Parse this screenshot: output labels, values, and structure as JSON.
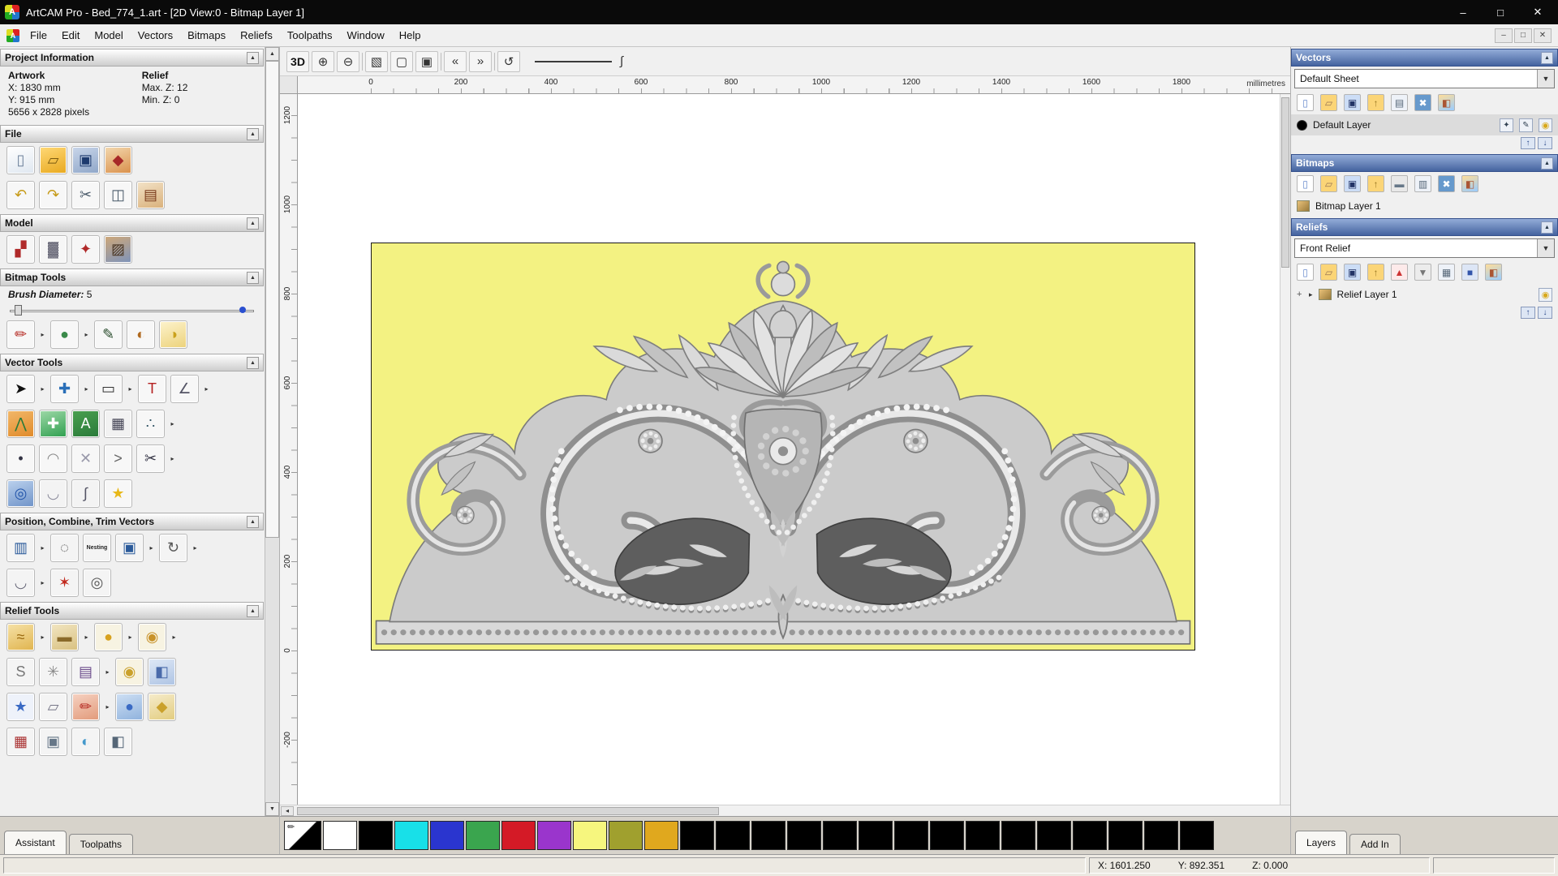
{
  "glyphs": {
    "collapse": "▲",
    "dropdown": "▼",
    "scroll_up": "▲",
    "scroll_down": "▼",
    "up": "↑",
    "down": "↓",
    "minimize": "–",
    "maximize": "□",
    "close": "✕",
    "logo_letter": "A",
    "left_arrow": "◂",
    "integral": "∫",
    "pencil": "✏",
    "plus": "+",
    "caret": "▸",
    "bulb": "●",
    "edit": "✎",
    "snap": "✦",
    "visibility": "◉"
  },
  "window": {
    "title": "ArtCAM Pro - Bed_774_1.art - [2D View:0 - Bitmap Layer 1]"
  },
  "menubar": {
    "items": [
      {
        "label": "File",
        "name": "menu-file"
      },
      {
        "label": "Edit",
        "name": "menu-edit"
      },
      {
        "label": "Model",
        "name": "menu-model"
      },
      {
        "label": "Vectors",
        "name": "menu-vectors"
      },
      {
        "label": "Bitmaps",
        "name": "menu-bitmaps"
      },
      {
        "label": "Reliefs",
        "name": "menu-reliefs"
      },
      {
        "label": "Toolpaths",
        "name": "menu-toolpaths"
      },
      {
        "label": "Window",
        "name": "menu-window"
      },
      {
        "label": "Help",
        "name": "menu-help"
      }
    ]
  },
  "assistant": {
    "project_information": {
      "title": "Project Information",
      "artwork_label": "Artwork",
      "relief_label": "Relief",
      "x": "X: 1830 mm",
      "y": "Y: 915 mm",
      "pixels": "5656 x 2828 pixels",
      "max_z": "Max. Z: 12",
      "min_z": "Min. Z: 0"
    },
    "sections": {
      "file": "File",
      "model": "Model",
      "bitmap_tools": "Bitmap Tools",
      "vector_tools": "Vector Tools",
      "position": "Position, Combine, Trim Vectors",
      "relief_tools": "Relief Tools"
    },
    "brush": {
      "label": "Brush Diameter:",
      "value": "5"
    },
    "file_icons_1": [
      {
        "name": "new-model-icon",
        "ch": "▯",
        "fg": "#6b7f99",
        "bg": "linear-gradient(160deg,#ffffff,#dfe7f0)"
      },
      {
        "name": "open-model-icon",
        "ch": "▱",
        "fg": "#7a5a10",
        "bg": "linear-gradient(160deg,#ffd977,#e8a81e)"
      },
      {
        "name": "save-model-icon",
        "ch": "▣",
        "fg": "#1d3a6e",
        "bg": "linear-gradient(160deg,#c9d6ea,#8fa6c8)"
      },
      {
        "name": "import-3d-model-icon",
        "ch": "◆",
        "fg": "#a62828",
        "bg": "linear-gradient(160deg,#f3d9b0,#d98f4a)"
      }
    ],
    "file_icons_2": [
      {
        "name": "undo-icon",
        "ch": "↶",
        "fg": "#c69a17",
        "bg": "#f7f7f7"
      },
      {
        "name": "redo-icon",
        "ch": "↷",
        "fg": "#c69a17",
        "bg": "#f7f7f7"
      },
      {
        "name": "cut-icon",
        "ch": "✂",
        "fg": "#4a5a6a",
        "bg": "#f7f7f7"
      },
      {
        "name": "copy-icon",
        "ch": "◫",
        "fg": "#4a5a6a",
        "bg": "#f7f7f7"
      },
      {
        "name": "paste-icon",
        "ch": "▤",
        "fg": "#7a3b1c",
        "bg": "linear-gradient(160deg,#f3e3c8,#d9b07a)"
      }
    ],
    "model_icons": [
      {
        "name": "invert-relief-icon",
        "ch": "▞",
        "fg": "#b02a2a",
        "bg": "#f6f6f6"
      },
      {
        "name": "relief-from-image-icon",
        "ch": "▓",
        "fg": "#556",
        "bg": "#f6f6f6"
      },
      {
        "name": "scale-model-icon",
        "ch": "✦",
        "fg": "#b02a2a",
        "bg": "#f6f6f6"
      },
      {
        "name": "load-image-icon",
        "ch": "▨",
        "fg": "#4a3624",
        "bg": "linear-gradient(160deg,#cfa878,#7d93bb)"
      }
    ],
    "bitmap_icons": [
      {
        "name": "paint-icon",
        "ch": "✏",
        "fg": "#b4261f",
        "bg": "#f7f7f7"
      },
      {
        "name": "paint-flyout-icon",
        "ch": "▸",
        "cls": "fly"
      },
      {
        "name": "paint-selective-icon",
        "ch": "●",
        "fg": "#3a8a4a",
        "bg": "#f7f7f7"
      },
      {
        "name": "paint-selective-flyout-icon",
        "ch": "▸",
        "cls": "fly"
      },
      {
        "name": "colour-picker-icon",
        "ch": "✎",
        "fg": "#274a2a",
        "bg": "#f7f7f7"
      },
      {
        "name": "edit-colours-icon",
        "ch": "◐",
        "fg": "#b06a20",
        "bg": "#f7f7f7"
      },
      {
        "name": "flood-fill-icon",
        "ch": "◑",
        "fg": "#caa11c",
        "bg": "linear-gradient(160deg,#fdf3cd,#ecd27a)"
      }
    ],
    "vector_icons_1": [
      {
        "name": "select-vectors-icon",
        "ch": "➤",
        "fg": "#111",
        "bg": "#f7f7f7"
      },
      {
        "name": "select-flyout-icon",
        "ch": "▸",
        "cls": "fly"
      },
      {
        "name": "transform-vectors-icon",
        "ch": "✚",
        "fg": "#2a6fb8",
        "bg": "#f7f7f7"
      },
      {
        "name": "transform-flyout-icon",
        "ch": "▸",
        "cls": "fly"
      },
      {
        "name": "create-rectangle-icon",
        "ch": "▭",
        "fg": "#333",
        "bg": "#f7f7f7"
      },
      {
        "name": "rectangle-flyout-icon",
        "ch": "▸",
        "cls": "fly"
      },
      {
        "name": "create-text-icon",
        "ch": "T",
        "fg": "#b42020",
        "bg": "#f7f7f7"
      },
      {
        "name": "measure-icon",
        "ch": "∠",
        "fg": "#556",
        "bg": "#f7f7f7"
      },
      {
        "name": "measure-flyout-icon",
        "ch": "▸",
        "cls": "fly"
      }
    ],
    "vector_icons_2": [
      {
        "name": "create-polyline-icon",
        "ch": "⋀",
        "fg": "#2a7a3a",
        "bg": "linear-gradient(160deg,#f2b86a,#e08a2a)"
      },
      {
        "name": "node-editing-icon",
        "ch": "✚",
        "fg": "#ffffff",
        "bg": "linear-gradient(160deg,#9fd9a8,#2f9f4f)"
      },
      {
        "name": "create-text-block-icon",
        "ch": "A",
        "fg": "#ffffff",
        "bg": "linear-gradient(160deg,#4aa04f,#2a7a3a)"
      },
      {
        "name": "snap-grid-icon",
        "ch": "▦",
        "fg": "#445",
        "bg": "#f2f2f2"
      },
      {
        "name": "array-points-icon",
        "ch": "∴",
        "fg": "#356",
        "bg": "#f7f7f7"
      },
      {
        "name": "array-points-flyout-icon",
        "ch": "▸",
        "cls": "fly"
      }
    ],
    "vector_icons_3": [
      {
        "name": "create-point-icon",
        "ch": "•",
        "fg": "#334",
        "bg": "#f7f7f7"
      },
      {
        "name": "fit-curve-icon",
        "ch": "◠",
        "fg": "#888",
        "bg": "#f7f7f7"
      },
      {
        "name": "bezier-editing-icon",
        "ch": "✕",
        "fg": "#99a",
        "bg": "#f7f7f7"
      },
      {
        "name": "mitre-corner-icon",
        "ch": ">",
        "fg": "#666",
        "bg": "#f7f7f7"
      },
      {
        "name": "trim-vectors-icon",
        "ch": "✂",
        "fg": "#334",
        "bg": "#f7f7f7"
      },
      {
        "name": "trim-flyout-icon",
        "ch": "▸",
        "cls": "fly"
      }
    ],
    "vector_icons_4": [
      {
        "name": "create-circle-icon",
        "ch": "◎",
        "fg": "#2255aa",
        "bg": "linear-gradient(160deg,#bcd2ee,#6f93c8)"
      },
      {
        "name": "create-ellipse-icon",
        "ch": "◡",
        "fg": "#889",
        "bg": "#f3f3f3"
      },
      {
        "name": "offset-vector-icon",
        "ch": "∫",
        "fg": "#556",
        "bg": "#f3f3f3"
      },
      {
        "name": "create-star-icon",
        "ch": "★",
        "fg": "#e8b818",
        "bg": "#f7f7f7"
      }
    ],
    "position_icons_1": [
      {
        "name": "block-paste-icon",
        "ch": "▥",
        "fg": "#2a5a9a",
        "bg": "#f4f4f4"
      },
      {
        "name": "block-paste-flyout-icon",
        "ch": "▸",
        "cls": "fly"
      },
      {
        "name": "circular-array-icon",
        "ch": "◌",
        "fg": "#444",
        "bg": "#f4f4f4"
      },
      {
        "name": "nesting-icon",
        "ch": "Nesting",
        "cls": "tiny",
        "fg": "#222",
        "bg": "#f4f4f4"
      },
      {
        "name": "align-vectors-icon",
        "ch": "▣",
        "fg": "#2a5a9a",
        "bg": "#f4f4f4"
      },
      {
        "name": "align-flyout-icon",
        "ch": "▸",
        "cls": "fly"
      },
      {
        "name": "copy-rotate-icon",
        "ch": "↻",
        "fg": "#555",
        "bg": "#f4f4f4"
      },
      {
        "name": "copy-rotate-flyout-icon",
        "ch": "▸",
        "cls": "fly"
      }
    ],
    "position_icons_2": [
      {
        "name": "fit-arc-icon",
        "ch": "◡",
        "fg": "#667",
        "bg": "#f4f4f4"
      },
      {
        "name": "fit-arc-flyout-icon",
        "ch": "▸",
        "cls": "fly"
      },
      {
        "name": "weld-vectors-icon",
        "ch": "✶",
        "fg": "#c22a1e",
        "bg": "#f4f4f4"
      },
      {
        "name": "ring-copy-icon",
        "ch": "◎",
        "fg": "#555",
        "bg": "#f4f4f4"
      }
    ],
    "relief_icons_1": [
      {
        "name": "sculpt-relief-icon",
        "ch": "≈",
        "fg": "#9a6a10",
        "bg": "linear-gradient(160deg,#f6e2a8,#e0b44e)"
      },
      {
        "name": "sculpt-flyout-icon",
        "ch": "▸",
        "cls": "fly"
      },
      {
        "name": "smooth-relief-icon",
        "ch": "▬",
        "fg": "#8a6a2a",
        "bg": "linear-gradient(160deg,#f2e6c2,#d8c080)"
      },
      {
        "name": "smooth-flyout-icon",
        "ch": "▸",
        "cls": "fly"
      },
      {
        "name": "add-clay-icon",
        "ch": "●",
        "fg": "#d8a21e",
        "bg": "#f7f3e2"
      },
      {
        "name": "add-clay-flyout-icon",
        "ch": "▸",
        "cls": "fly"
      },
      {
        "name": "shape-editor-icon",
        "ch": "◉",
        "fg": "#c8922a",
        "bg": "#f7f3e2"
      },
      {
        "name": "shape-editor-flyout-icon",
        "ch": "▸",
        "cls": "fly"
      }
    ],
    "relief_icons_2": [
      {
        "name": "smart-engrave-icon",
        "ch": "S",
        "fg": "#777",
        "bg": "#f4f4f4"
      },
      {
        "name": "weave-wizard-icon",
        "ch": "✳",
        "fg": "#8a8a8a",
        "bg": "#f4f4f4"
      },
      {
        "name": "relief-clipart-icon",
        "ch": "▤",
        "fg": "#6a4a8a",
        "bg": "#f4f4f4"
      },
      {
        "name": "clipart-flyout-icon",
        "ch": "▸",
        "cls": "fly"
      },
      {
        "name": "interactive-sculpt-icon",
        "ch": "◉",
        "fg": "#caa12c",
        "bg": "#f7f3e2"
      },
      {
        "name": "constant-height-icon",
        "ch": "◧",
        "fg": "#4a6aaa",
        "bg": "linear-gradient(160deg,#dfe8f6,#aec4e4)"
      }
    ],
    "relief_icons_3": [
      {
        "name": "star-wizard-icon",
        "ch": "★",
        "fg": "#3a6ac4",
        "bg": "#eef2fa"
      },
      {
        "name": "envelope-distort-icon",
        "ch": "▱",
        "fg": "#778",
        "bg": "#f4f4f4"
      },
      {
        "name": "paint-relief-icon",
        "ch": "✏",
        "fg": "#b4261f",
        "bg": "linear-gradient(160deg,#f6d2c2,#e29a7a)"
      },
      {
        "name": "paint-relief-flyout-icon",
        "ch": "▸",
        "cls": "fly"
      },
      {
        "name": "texture-relief-icon",
        "ch": "●",
        "fg": "#3a6ac4",
        "bg": "linear-gradient(160deg,#cfe0f4,#8fb2dd)"
      },
      {
        "name": "two-rail-sweep-icon",
        "ch": "◆",
        "fg": "#caa12c",
        "bg": "linear-gradient(160deg,#f6eccc,#e2cc7e)"
      }
    ],
    "relief_icons_4": [
      {
        "name": "face-wizard-icon",
        "ch": "▦",
        "fg": "#a33",
        "bg": "#f4f4f4"
      },
      {
        "name": "isolate-relief-icon",
        "ch": "▣",
        "fg": "#678",
        "bg": "#f4f4f4"
      },
      {
        "name": "relief-layer-icon",
        "ch": "◐",
        "fg": "#4499cc",
        "bg": "#f4f4f4"
      },
      {
        "name": "mirror-relief-icon",
        "ch": "◧",
        "fg": "#567",
        "bg": "#f4f4f4"
      }
    ],
    "tabs": [
      {
        "label": "Assistant",
        "name": "tab-assistant",
        "active": true
      },
      {
        "label": "Toolpaths",
        "name": "tab-toolpaths",
        "active": false
      }
    ]
  },
  "viewport": {
    "toolbar": [
      {
        "name": "view-3d-button",
        "ch": "3D",
        "cls": "txt"
      },
      {
        "name": "zoom-in-icon",
        "ch": "⊕"
      },
      {
        "name": "zoom-out-icon",
        "ch": "⊖"
      },
      {
        "name": "toolbar-separator-1",
        "cls": "sep"
      },
      {
        "name": "zoom-window-icon",
        "ch": "▧"
      },
      {
        "name": "zoom-page-icon",
        "ch": "▢"
      },
      {
        "name": "zoom-objects-icon",
        "ch": "▣"
      },
      {
        "name": "toolbar-separator-2",
        "cls": "sep"
      },
      {
        "name": "bitmap-layer-prev-icon",
        "ch": "«"
      },
      {
        "name": "bitmap-layer-next-icon",
        "ch": "»"
      },
      {
        "name": "toolbar-separator-3",
        "cls": "sep"
      },
      {
        "name": "zoom-previous-icon",
        "ch": "↺"
      }
    ],
    "ruler": {
      "units": "millimetres",
      "h_ticks": [
        "0",
        "200",
        "400",
        "600",
        "800",
        "1000",
        "1200",
        "1400",
        "1600",
        "1800"
      ],
      "v_ticks": [
        "1200",
        "1000",
        "800",
        "600",
        "400",
        "200",
        "0",
        "-200"
      ]
    }
  },
  "layers_panel": {
    "vectors": {
      "title": "Vectors",
      "selector": "Default Sheet",
      "layer": "Default Layer",
      "toolbar": [
        {
          "name": "new-vector-layer-icon",
          "ch": "▯",
          "fg": "#6688cc",
          "bg": "#ffffff"
        },
        {
          "name": "open-vector-layer-icon",
          "ch": "▱",
          "fg": "#997755",
          "bg": "#fbd577"
        },
        {
          "name": "save-vector-layer-icon",
          "ch": "▣",
          "fg": "#223366",
          "bg": "#ccddf6"
        },
        {
          "name": "import-vectors-icon",
          "ch": "↑",
          "fg": "#997722",
          "bg": "#fbd577"
        },
        {
          "name": "show-all-layers-icon",
          "ch": "▤",
          "fg": "#556677",
          "bg": "#eef2f8"
        },
        {
          "name": "delete-vector-layer-icon",
          "ch": "✖",
          "fg": "#ffffff",
          "bg": "#6699cc"
        },
        {
          "name": "merge-vector-layers-icon",
          "ch": "◧",
          "fg": "#aa5533",
          "bg": "linear-gradient(160deg,#ffdd99,#99ccff)"
        }
      ]
    },
    "bitmaps": {
      "title": "Bitmaps",
      "layer": "Bitmap Layer 1",
      "toolbar": [
        {
          "name": "new-bitmap-layer-icon",
          "ch": "▯",
          "fg": "#6688cc",
          "bg": "#ffffff"
        },
        {
          "name": "open-bitmap-layer-icon",
          "ch": "▱",
          "fg": "#997755",
          "bg": "#fbd577"
        },
        {
          "name": "save-bitmap-layer-icon",
          "ch": "▣",
          "fg": "#223366",
          "bg": "#ccddf6"
        },
        {
          "name": "import-bitmap-icon",
          "ch": "↑",
          "fg": "#997722",
          "bg": "#fbd577"
        },
        {
          "name": "transparency-icon",
          "ch": "▬",
          "fg": "#667788",
          "bg": "#e8e8e8"
        },
        {
          "name": "combine-bitmaps-icon",
          "ch": "▥",
          "fg": "#556677",
          "bg": "#eef2f8"
        },
        {
          "name": "delete-bitmap-layer-icon",
          "ch": "✖",
          "fg": "#ffffff",
          "bg": "#6699cc"
        },
        {
          "name": "merge-bitmap-layers-icon",
          "ch": "◧",
          "fg": "#aa5533",
          "bg": "linear-gradient(160deg,#ffdd99,#99ccff)"
        }
      ]
    },
    "reliefs": {
      "title": "Reliefs",
      "selector": "Front Relief",
      "layer": "Relief Layer 1",
      "toolbar": [
        {
          "name": "new-relief-layer-icon",
          "ch": "▯",
          "fg": "#6688cc",
          "bg": "#ffffff"
        },
        {
          "name": "open-relief-layer-icon",
          "ch": "▱",
          "fg": "#997755",
          "bg": "#fbd577"
        },
        {
          "name": "save-relief-layer-icon",
          "ch": "▣",
          "fg": "#223366",
          "bg": "#ccddf6"
        },
        {
          "name": "import-relief-icon",
          "ch": "↑",
          "fg": "#997722",
          "bg": "#fbd577"
        },
        {
          "name": "add-relief-layer-icon",
          "ch": "▲",
          "fg": "#cc3333",
          "bg": "#fdeaea"
        },
        {
          "name": "subtract-relief-layer-icon",
          "ch": "▼",
          "fg": "#777777",
          "bg": "#ececec"
        },
        {
          "name": "merge-high-icon",
          "ch": "▦",
          "fg": "#556677",
          "bg": "#eef2f8"
        },
        {
          "name": "merge-low-icon",
          "ch": "■",
          "fg": "#3355aa",
          "bg": "#dde6f6"
        },
        {
          "name": "duplicate-relief-layer-icon",
          "ch": "◧",
          "fg": "#aa5533",
          "bg": "linear-gradient(160deg,#ffdd99,#99ccff)"
        }
      ]
    },
    "tabs": [
      {
        "label": "Layers",
        "name": "tab-layers",
        "active": true
      },
      {
        "label": "Add In",
        "name": "tab-add-in",
        "active": false
      }
    ]
  },
  "palette": {
    "colors": [
      "#ffffff",
      "#000000",
      "#18e0e8",
      "#2a35cf",
      "#3aa54e",
      "#d41a26",
      "#9a35cc",
      "#f6f67e",
      "#a0a02e",
      "#e0a81e",
      "#000000",
      "#000000",
      "#000000",
      "#000000",
      "#000000",
      "#000000",
      "#000000",
      "#000000",
      "#000000",
      "#000000",
      "#000000",
      "#000000",
      "#000000",
      "#000000",
      "#000000"
    ]
  },
  "statusbar": {
    "x": "X: 1601.250",
    "y": "Y: 892.351",
    "z": "Z: 0.000"
  }
}
